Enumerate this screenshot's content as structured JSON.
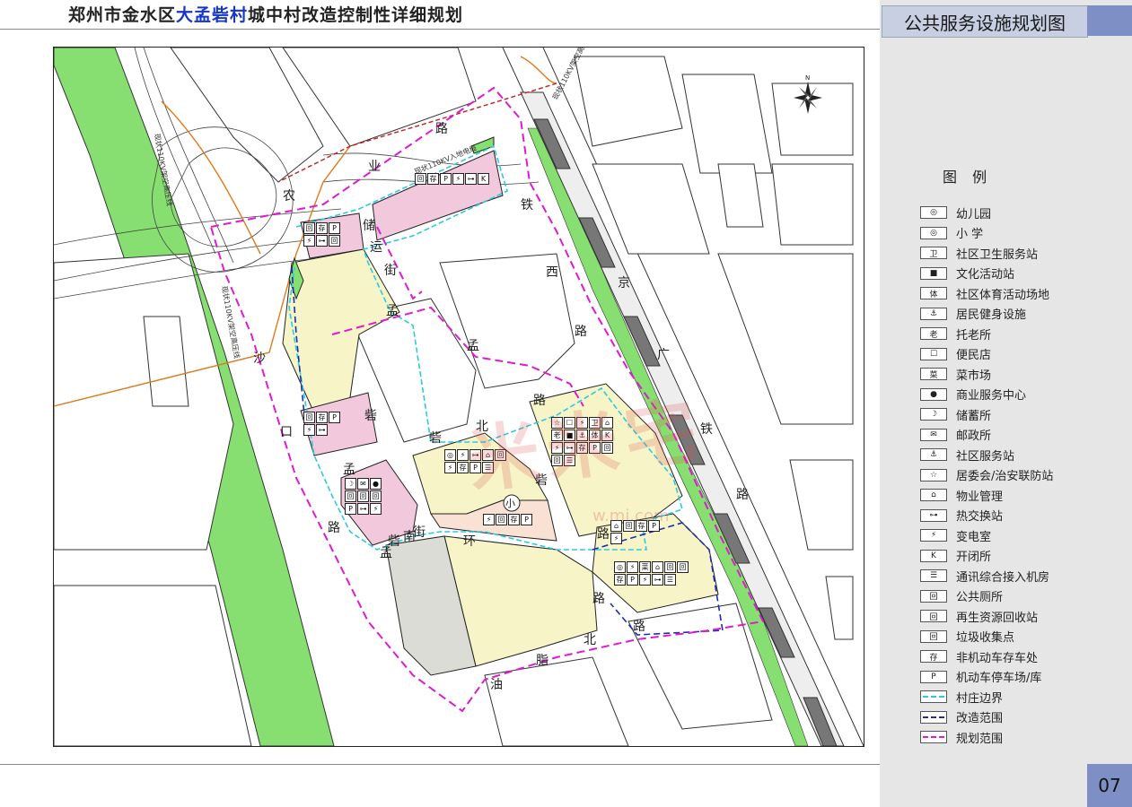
{
  "header": {
    "title_prefix": "郑州市金水区",
    "title_highlight": "大孟砦村",
    "title_suffix": "城中村改造控制性详细规划",
    "sheet_title": "公共服务设施规划图",
    "page_number": "07"
  },
  "map": {
    "roads": {
      "nongye_1": "农",
      "nongye_2": "业",
      "nongye_3": "路",
      "chukou_1": "储",
      "chukou_2": "运",
      "chukou_3": "街",
      "tiexi_1": "铁",
      "tiexi_2": "西",
      "tiexi_3": "路",
      "jingguang_1": "京",
      "jingguang_2": "广",
      "jingguang_3": "铁",
      "jingguang_4": "路",
      "mengzhai_1": "孟",
      "mengzhai_2": "砦",
      "mengzhai_3": "北",
      "mengzhai_4": "路",
      "mengzhaibei_1": "北",
      "mengzhaibei_2": "砦",
      "shakou_1": "沙",
      "shakou_2": "口",
      "shakou_3": "路",
      "meng_1": "孟",
      "meng_2": "孟",
      "meng_3": "砦",
      "meng_4": "砦",
      "nanjie_1": "南",
      "nanjie_2": "街",
      "huanjie_1": "环",
      "zhai_1": "砦",
      "lu_1": "路",
      "lu_2": "路",
      "youzhi_1": "油",
      "youzhi_2": "脂",
      "youzhi_3": "北",
      "youzhi_4": "路"
    },
    "annotations": {
      "powerline_left": "现状110KV架空高压线",
      "powerline_right": "现状110KV架空高压线",
      "powerline_left2": "现状110KV架空高压线",
      "cable_corridor": "现状110KV入地电缆"
    },
    "school_mark": "小",
    "watermark_text": "米米宅",
    "watermark_url": "w.mi.com",
    "north_label": "N"
  },
  "facility_groups": [
    {
      "items": [
        "回",
        "存",
        "P",
        "⚡",
        "⊶",
        "K"
      ]
    },
    {
      "items": [
        "回",
        "存",
        "P",
        "⚡",
        "⊶",
        "回"
      ]
    },
    {
      "items": [
        "回",
        "存",
        "P",
        "⚡",
        "⊶"
      ]
    },
    {
      "items": [
        "☽",
        "✉",
        "●",
        "回",
        "回",
        "回",
        "P",
        "⊶",
        "⚡"
      ]
    },
    {
      "items": [
        "◎",
        "⚡",
        "⊶",
        "⌂",
        "回",
        "⚡",
        "存",
        "P",
        "☰"
      ]
    },
    {
      "items": [
        "⚡",
        "回",
        "存",
        "P"
      ]
    },
    {
      "items": [
        "☆",
        "☐",
        "⚡",
        "卫",
        "⌂",
        "老",
        "■",
        "⚓",
        "体",
        "K",
        "⚡",
        "⊶",
        "存",
        "P",
        "回",
        "回",
        "☰"
      ]
    },
    {
      "items": [
        "⌂",
        "回",
        "存",
        "P",
        "⚡"
      ]
    },
    {
      "items": [
        "◎",
        "⚡",
        "菜",
        "⌂",
        "回",
        "回",
        "存",
        "P",
        "⚡",
        "⊶",
        "☰"
      ]
    }
  ],
  "legend": {
    "title": "图 例",
    "items": [
      {
        "icon": "◎",
        "label": "幼儿园"
      },
      {
        "icon": "◎",
        "label": "小 学"
      },
      {
        "icon": "卫",
        "label": "社区卫生服务站"
      },
      {
        "icon": "■",
        "label": "文化活动站"
      },
      {
        "icon": "体",
        "label": "社区体育活动场地"
      },
      {
        "icon": "⚓",
        "label": "居民健身设施"
      },
      {
        "icon": "老",
        "label": "托老所"
      },
      {
        "icon": "☐",
        "label": "便民店"
      },
      {
        "icon": "菜",
        "label": "菜市场"
      },
      {
        "icon": "●",
        "label": "商业服务中心"
      },
      {
        "icon": "☽",
        "label": "储蓄所"
      },
      {
        "icon": "✉",
        "label": "邮政所"
      },
      {
        "icon": "⚓",
        "label": "社区服务站"
      },
      {
        "icon": "☆",
        "label": "居委会/治安联防站"
      },
      {
        "icon": "⌂",
        "label": "物业管理"
      },
      {
        "icon": "⊶",
        "label": "热交换站"
      },
      {
        "icon": "⚡",
        "label": "变电室"
      },
      {
        "icon": "K",
        "label": "开闭所"
      },
      {
        "icon": "☰",
        "label": "通讯综合接入机房"
      },
      {
        "icon": "回",
        "label": "公共厕所"
      },
      {
        "icon": "回",
        "label": "再生资源回收站"
      },
      {
        "icon": "回",
        "label": "垃圾收集点"
      },
      {
        "icon": "存",
        "label": "非机动车存车处"
      },
      {
        "icon": "P",
        "label": "机动车停车场/库"
      }
    ],
    "lines": [
      {
        "color": "#2ec9e0",
        "label": "村庄边界"
      },
      {
        "color": "#1a2fb0",
        "label": "改造范围"
      },
      {
        "color": "#e01ad0",
        "label": "规划范围"
      }
    ]
  },
  "colors": {
    "residential": "#f7f5c8",
    "commercial": "#f1c8dc",
    "school": "#f9e2d4",
    "green": "#86df70",
    "plaza": "#dcdcd6",
    "village_boundary": "#2ec9e0",
    "renewal_boundary": "#1a2fb0",
    "planning_boundary": "#e01ad0"
  }
}
